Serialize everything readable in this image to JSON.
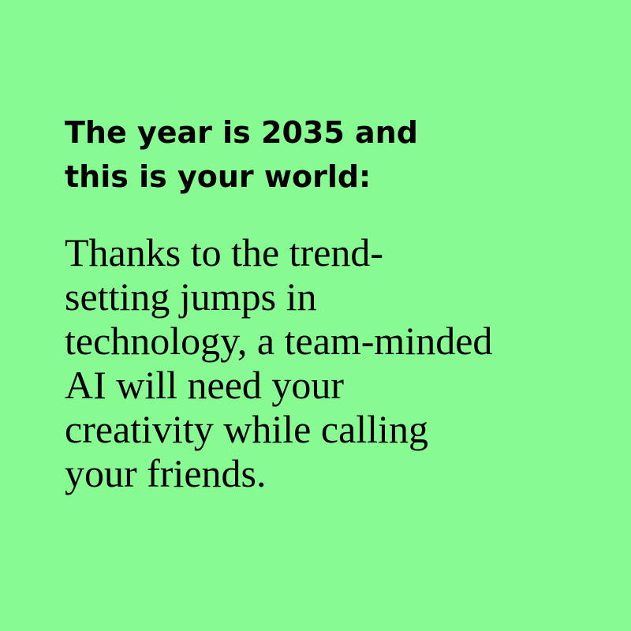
{
  "colors": {
    "background": "#88fa92",
    "text": "#000000"
  },
  "heading": {
    "lines": [
      "The year is 2035 and",
      "this is your world:"
    ]
  },
  "body": {
    "lines": [
      "Thanks to the trend-",
      "setting jumps in",
      "technology, a team-minded",
      "AI will need your",
      "creativity while calling",
      "your friends."
    ]
  }
}
